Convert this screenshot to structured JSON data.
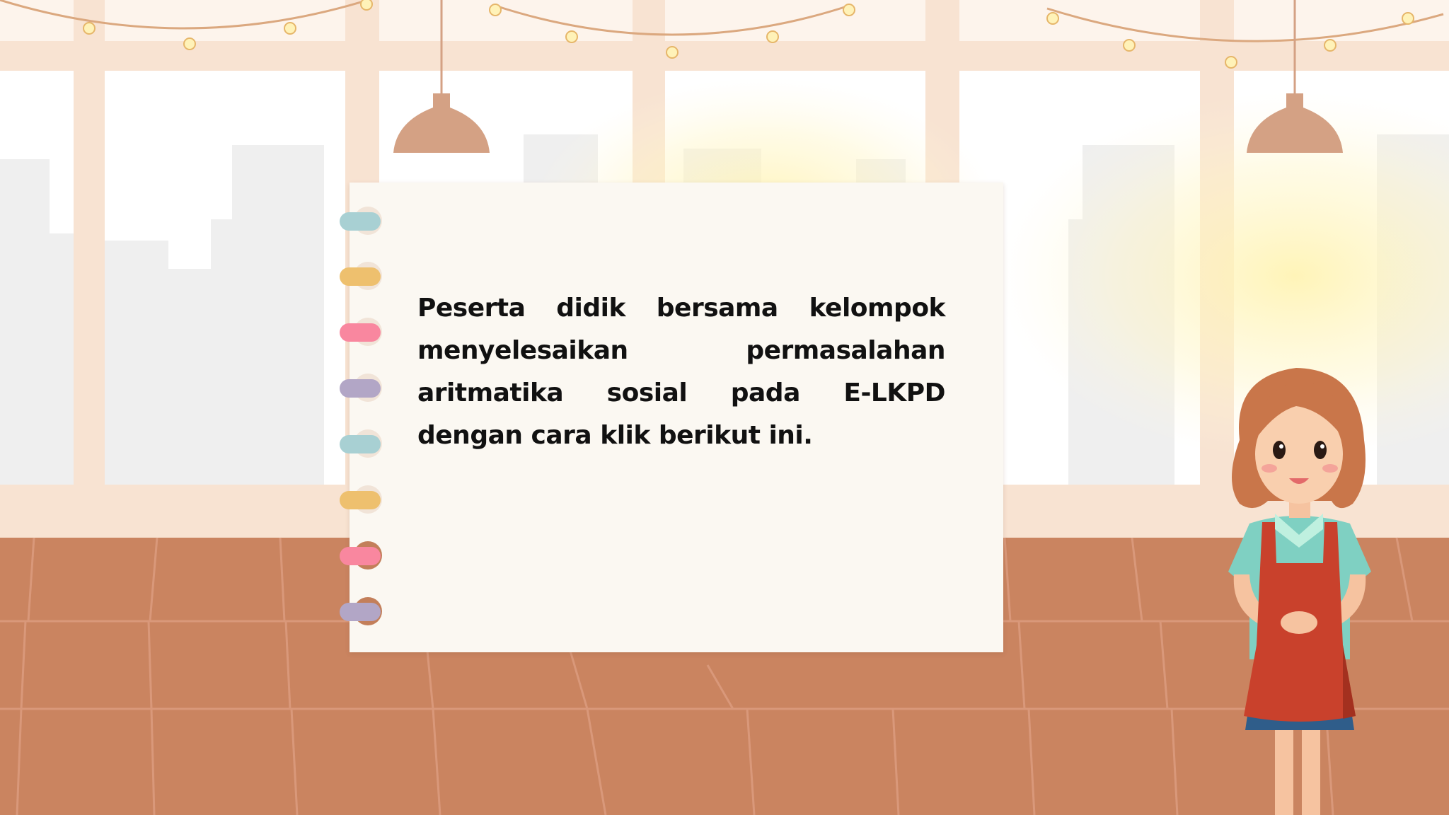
{
  "slide": {
    "instruction_text": "Peserta didik bersama kelompok menyelesaikan permasalahan aritmatika sosial pada E-LKPD dengan cara klik berikut ini."
  },
  "colors": {
    "wall": "#fdf4ec",
    "window_frame": "#f8e3d2",
    "floor": "#ca8460",
    "floor_line": "#d9987a",
    "notebook": "#fbf8f2",
    "lamp": "#d4a184",
    "ring_colors": [
      "#a8d0d3",
      "#eec06e",
      "#f9879f",
      "#b2a6c6"
    ]
  },
  "icons": [
    "string-lights",
    "pendant-lamp",
    "notebook-rings",
    "waitress-character"
  ]
}
